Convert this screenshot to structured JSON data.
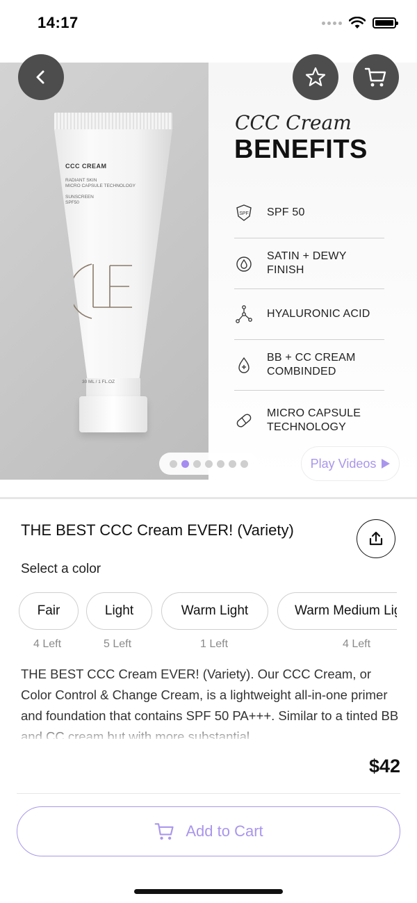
{
  "status_bar": {
    "time": "14:17"
  },
  "hero": {
    "product_brand": "CCC CREAM",
    "product_lines": [
      "RADIANT SKIN",
      "MICRO CAPSULE TECHNOLOGY"
    ],
    "product_spf_lines": [
      "SUNSCREEN",
      "SPF50"
    ],
    "product_volume": "30 ML / 1 FL.OZ",
    "benefits_script": "CCC Cream",
    "benefits_title": "BENEFITS",
    "benefits": [
      {
        "icon": "spf-shield-icon",
        "label": "SPF 50"
      },
      {
        "icon": "drop-icon",
        "label": "SATIN + DEWY FINISH"
      },
      {
        "icon": "molecule-icon",
        "label": "HYALURONIC ACID"
      },
      {
        "icon": "drop-plus-icon",
        "label": "BB + CC CREAM COMBINDED"
      },
      {
        "icon": "capsule-icon",
        "label": "MICRO CAPSULE TECHNOLOGY"
      }
    ],
    "pager": {
      "total": 7,
      "active": 2
    },
    "play_videos_label": "Play Videos"
  },
  "product": {
    "title": "THE BEST CCC Cream EVER! (Variety)",
    "select_color_label": "Select a color",
    "colors": [
      {
        "name": "Fair",
        "stock": "4 Left"
      },
      {
        "name": "Light",
        "stock": "5 Left"
      },
      {
        "name": "Warm Light",
        "stock": "1 Left"
      },
      {
        "name": "Warm Medium Light",
        "stock": "4 Left"
      }
    ],
    "description": "THE BEST CCC Cream EVER! (Variety). Our CCC Cream, or Color Control & Change Cream, is a lightweight all-in-one primer and foundation that contains SPF 50 PA+++. Similar to a tinted BB and CC cream but with more substantial"
  },
  "checkout": {
    "price": "$42",
    "add_to_cart_label": "Add to Cart"
  },
  "colors": {
    "accent": "#a996ec",
    "pager_active": "#a58cf0",
    "overlay_button": "#4d4d4d"
  }
}
